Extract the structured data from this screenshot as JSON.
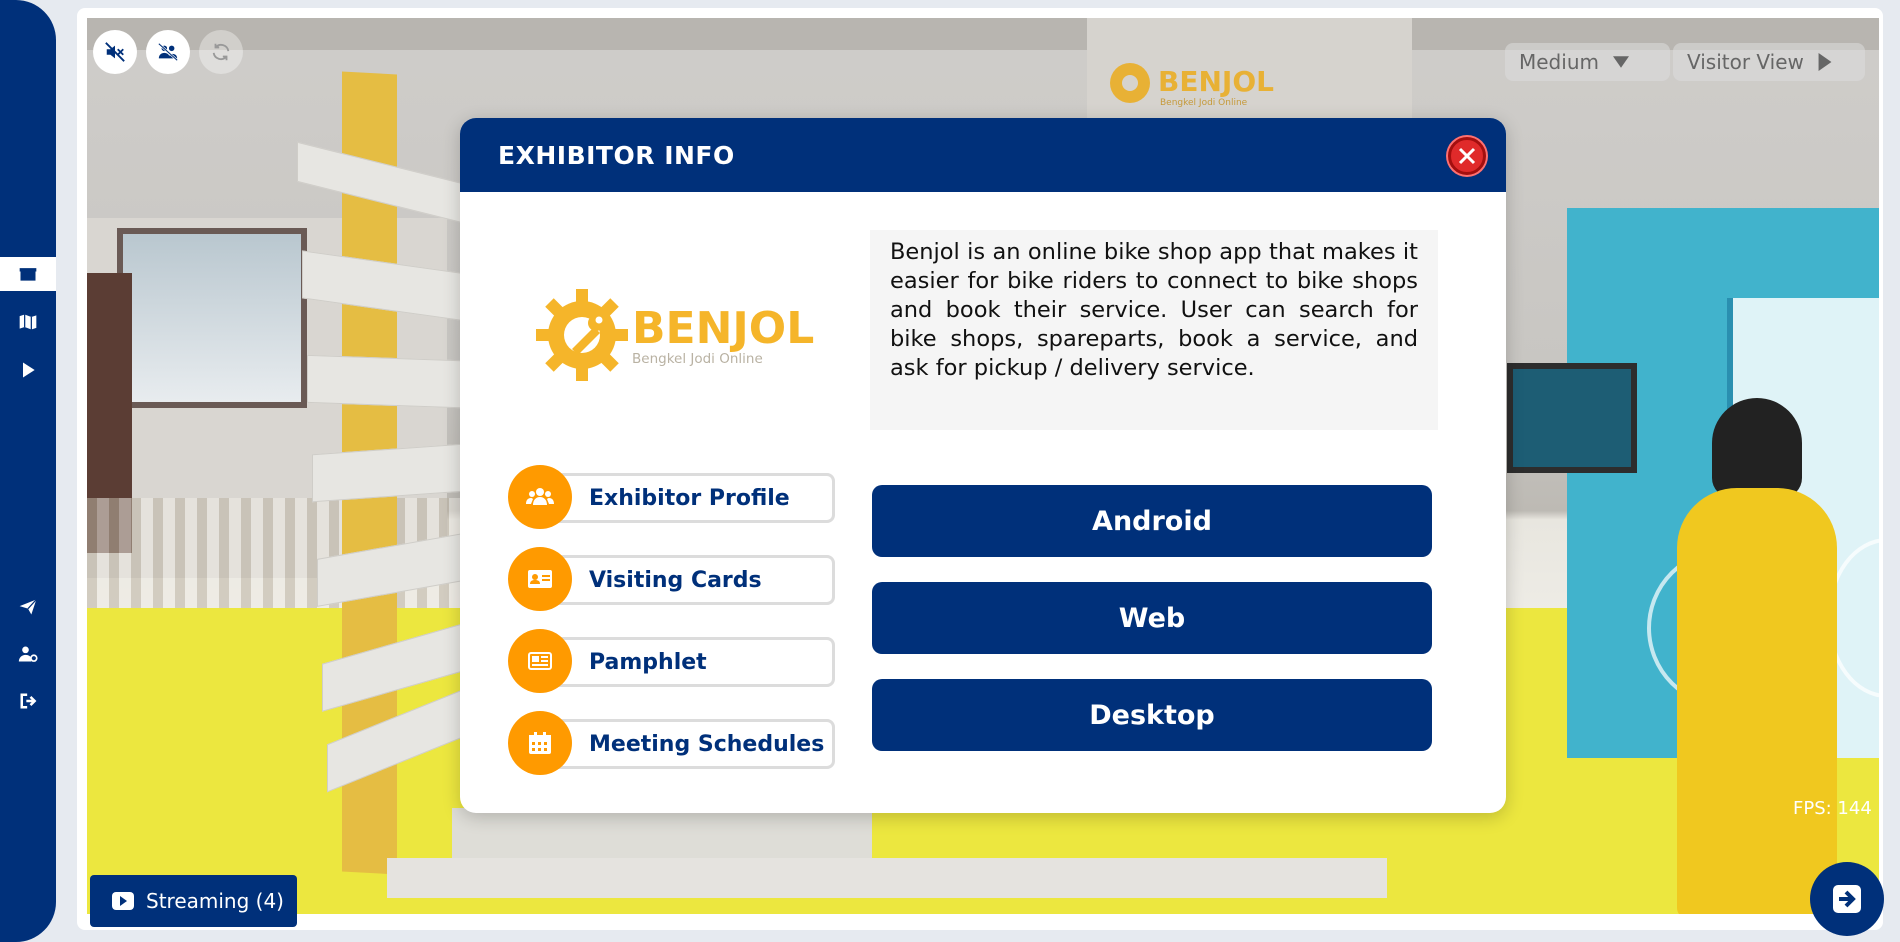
{
  "sidebar": {
    "items": [
      {
        "icon": "box-icon",
        "active": true
      },
      {
        "icon": "map-icon",
        "active": false
      },
      {
        "icon": "play-icon",
        "active": false
      },
      {
        "icon": "paper-plane-icon",
        "active": false
      },
      {
        "icon": "user-settings-icon",
        "active": false
      },
      {
        "icon": "logout-icon",
        "active": false
      }
    ]
  },
  "top_controls": {
    "quality_label": "Medium",
    "view_label": "Visitor View"
  },
  "modal": {
    "title": "EXHIBITOR INFO",
    "logo": {
      "brand": "BENJOL",
      "tagline": "Bengkel Jodi Online"
    },
    "description": "Benjol is an online bike shop app that makes it easier for bike riders to connect to bike shops and book their service. User can search for bike shops, spareparts, book a service, and ask for pickup / delivery service.",
    "menu": [
      {
        "label": "Exhibitor Profile",
        "icon": "users-icon"
      },
      {
        "label": "Visiting Cards",
        "icon": "id-card-icon"
      },
      {
        "label": "Pamphlet",
        "icon": "newspaper-icon"
      },
      {
        "label": "Meeting Schedules",
        "icon": "calendar-icon"
      }
    ],
    "platforms": [
      "Android",
      "Web",
      "Desktop"
    ]
  },
  "scene": {
    "booth_brand": "BENJOL",
    "booth_tagline": "Bengkel Jodi Online"
  },
  "fps": "FPS: 144",
  "streaming": {
    "label": "Streaming (4)"
  },
  "colors": {
    "primary": "#00307a",
    "accent": "#ff9a00",
    "close": "#e02a2a",
    "logo": "#f5b52a"
  }
}
